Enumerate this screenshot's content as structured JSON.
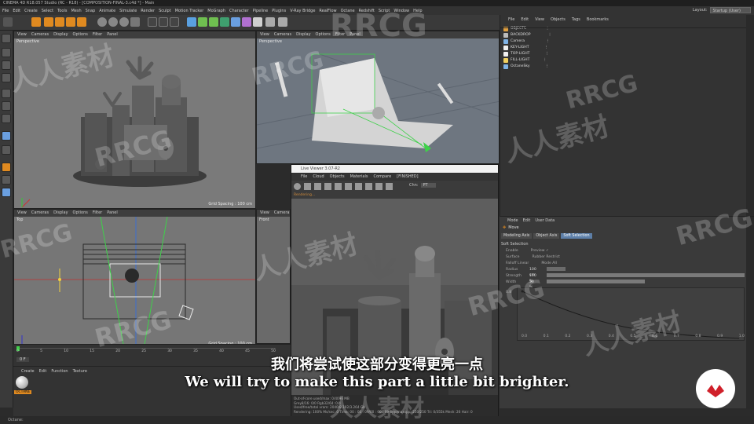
{
  "window": {
    "title": "CINEMA 4D R18.057 Studio (RC - R18) - [COMPOSITION-FINAL-3.c4d *] - Main"
  },
  "menubar": {
    "items": [
      "File",
      "Edit",
      "Create",
      "Select",
      "Tools",
      "Mesh",
      "Snap",
      "Animate",
      "Simulate",
      "Render",
      "Sculpt",
      "Motion Tracker",
      "MoGraph",
      "Character",
      "Pipeline",
      "Plugins",
      "V-Ray Bridge",
      "RealFlow",
      "Octane",
      "Redshift",
      "Script",
      "Window",
      "Help"
    ],
    "layout_label": "Layout:",
    "layout_value": "Startup (User)"
  },
  "viewports": {
    "menu": [
      "View",
      "Cameras",
      "Display",
      "Options",
      "Filter",
      "Panel"
    ],
    "perspective_left": {
      "label": "Perspective",
      "grid": "Grid Spacing : 100 cm"
    },
    "perspective_right": {
      "label": "Perspective"
    },
    "top": {
      "label": "Top",
      "grid": "Grid Spacing : 100 cm"
    },
    "front": {
      "label": "Front"
    }
  },
  "object_manager": {
    "menu": [
      "File",
      "Edit",
      "View",
      "Objects",
      "Tags",
      "Bookmarks"
    ],
    "objects": [
      {
        "name": "OBJECTS",
        "color": "#e0a040"
      },
      {
        "name": "BACKDROP",
        "color": "#bbbbbb"
      },
      {
        "name": "Camera",
        "color": "#7fb3e6"
      },
      {
        "name": "KEY-LIGHT",
        "color": "#f0f0f0"
      },
      {
        "name": "TOP-LIGHT",
        "color": "#f0f0f0"
      },
      {
        "name": "FILL-LIGHT",
        "color": "#f0d060"
      },
      {
        "name": "OctaneSky",
        "color": "#7fb3e6"
      }
    ]
  },
  "attributes": {
    "menu": [
      "Mode",
      "Edit",
      "User Data"
    ],
    "tool_name": "Move",
    "tabs": [
      "Modeling Axis",
      "Object Axis",
      "Soft Selection"
    ],
    "active_tab": "Soft Selection",
    "section_title": "Soft Selection",
    "rows": [
      {
        "label": "Enable",
        "extra": "Preview ✓"
      },
      {
        "label": "Surface",
        "extra": "Rubber          Restrict"
      },
      {
        "label": "Falloff  Linear",
        "extra": "Mode  All"
      },
      {
        "label": "Radius",
        "value": "100 cm"
      },
      {
        "label": "Strength",
        "value": "100 %"
      },
      {
        "label": "Width",
        "value": "50 %"
      }
    ],
    "graph_ticks": [
      "0.0",
      "0.1",
      "0.2",
      "0.3",
      "0.4",
      "0.5",
      "0.6",
      "0.7",
      "0.8",
      "0.9",
      "1.0"
    ],
    "graph_ylabel": "0.8"
  },
  "live_viewer": {
    "title": "Live Viewer 3.07-R2",
    "menu": [
      "File",
      "Cloud",
      "Objects",
      "Materials",
      "Compare",
      "[FINISHED]"
    ],
    "channel_label": "Chn:",
    "channel_value": "PT",
    "status_text": "Rendering...",
    "info_lines": [
      "Out-of-core used/max: 0/4096 MB",
      "Grey8/16: 0/0        Rgb32/64: 0/4",
      "Used/free/total vram: 2040/8.192/3.264 Gb",
      "Rendering: 100%  Ms/sec: 0   Time: 00 : 00 : 09/00 : 00 : 09   Spp/maxspp: 250/250   Tri: 0/355k   Mesh: 26   Hair: 0"
    ]
  },
  "timeline": {
    "ticks": [
      "0",
      "5",
      "10",
      "15",
      "20",
      "25",
      "30",
      "35",
      "40",
      "45",
      "50"
    ],
    "current_frame": "0 F"
  },
  "material_manager": {
    "menu": [
      "Create",
      "Edit",
      "Function",
      "Texture"
    ],
    "material_name": "OCTANE"
  },
  "statusbar": {
    "text": "Octane:"
  },
  "subtitles": {
    "chinese": "我们将尝试使这部分变得更亮一点",
    "english": "We will try to make this part a little bit brighter."
  },
  "watermarks": {
    "rrcg": "RRCG",
    "cn": "人人素材"
  },
  "colors": {
    "accent_tab": "#5d7fa8",
    "orange": "#e08a20",
    "logo_red": "#d0202a"
  }
}
